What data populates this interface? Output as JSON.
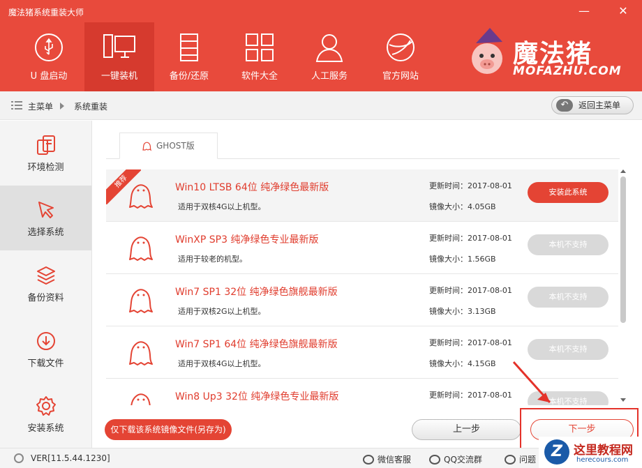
{
  "app": {
    "title": "魔法猪系统重装大师",
    "min_icon": "minimize-icon",
    "close_icon": "close-icon"
  },
  "nav": [
    {
      "label": "U 盘启动",
      "icon": "usb-icon",
      "active": false
    },
    {
      "label": "一键装机",
      "icon": "monitor-icon",
      "active": true
    },
    {
      "label": "备份/还原",
      "icon": "server-icon",
      "active": false
    },
    {
      "label": "软件大全",
      "icon": "grid-icon",
      "active": false
    },
    {
      "label": "人工服务",
      "icon": "user-icon",
      "active": false
    },
    {
      "label": "官方网站",
      "icon": "globe-icon",
      "active": false
    }
  ],
  "logo": {
    "text": "魔法猪",
    "sub": "MOFAZHU.COM"
  },
  "breadcrumb": {
    "root": "主菜单",
    "current": "系统重装",
    "back": "返回主菜单"
  },
  "sidebar": [
    {
      "label": "环境检测",
      "icon": "device-icon",
      "active": false
    },
    {
      "label": "选择系统",
      "icon": "cursor-icon",
      "active": true
    },
    {
      "label": "备份资料",
      "icon": "layers-icon",
      "active": false
    },
    {
      "label": "下载文件",
      "icon": "download-icon",
      "active": false
    },
    {
      "label": "安装系统",
      "icon": "gear-icon",
      "active": false
    }
  ],
  "tab": {
    "label": "GHOST版"
  },
  "ribbon": "推荐",
  "systems": [
    {
      "name": "Win10 LTSB 64位 纯净绿色最新版",
      "desc": "适用于双核4G以上机型。",
      "updated": "更新时间：2017-08-01",
      "size": "镜像大小：4.05GB",
      "action": "安装此系统",
      "enabled": true
    },
    {
      "name": "WinXP SP3 纯净绿色专业最新版",
      "desc": "适用于较老的机型。",
      "updated": "更新时间：2017-08-01",
      "size": "镜像大小：1.56GB",
      "action": "本机不支持",
      "enabled": false
    },
    {
      "name": "Win7 SP1 32位 纯净绿色旗舰最新版",
      "desc": "适用于双核2G以上机型。",
      "updated": "更新时间：2017-08-01",
      "size": "镜像大小：3.13GB",
      "action": "本机不支持",
      "enabled": false
    },
    {
      "name": "Win7 SP1 64位 纯净绿色旗舰最新版",
      "desc": "适用于双核4G以上机型。",
      "updated": "更新时间：2017-08-01",
      "size": "镜像大小：4.15GB",
      "action": "本机不支持",
      "enabled": false
    },
    {
      "name": "Win8 Up3 32位 纯净绿色专业最新版",
      "desc": "",
      "updated": "更新时间：2017-08-01",
      "size": "",
      "action": "本机不支持",
      "enabled": false
    }
  ],
  "buttons": {
    "download": "仅下载该系统镜像文件(另存为)",
    "prev": "上一步",
    "next": "下一步"
  },
  "status": {
    "version": "VER[11.5.44.1230]",
    "wechat": "微信客服",
    "qq": "QQ交流群",
    "help": "问题"
  },
  "watermark": {
    "badge": "Z",
    "title": "这里教程网",
    "url": "herecours.com"
  },
  "colors": {
    "brand": "#e84a3c",
    "brand_dark": "#d63a2e",
    "accent": "#e44434",
    "disabled": "#d9d9d9"
  }
}
